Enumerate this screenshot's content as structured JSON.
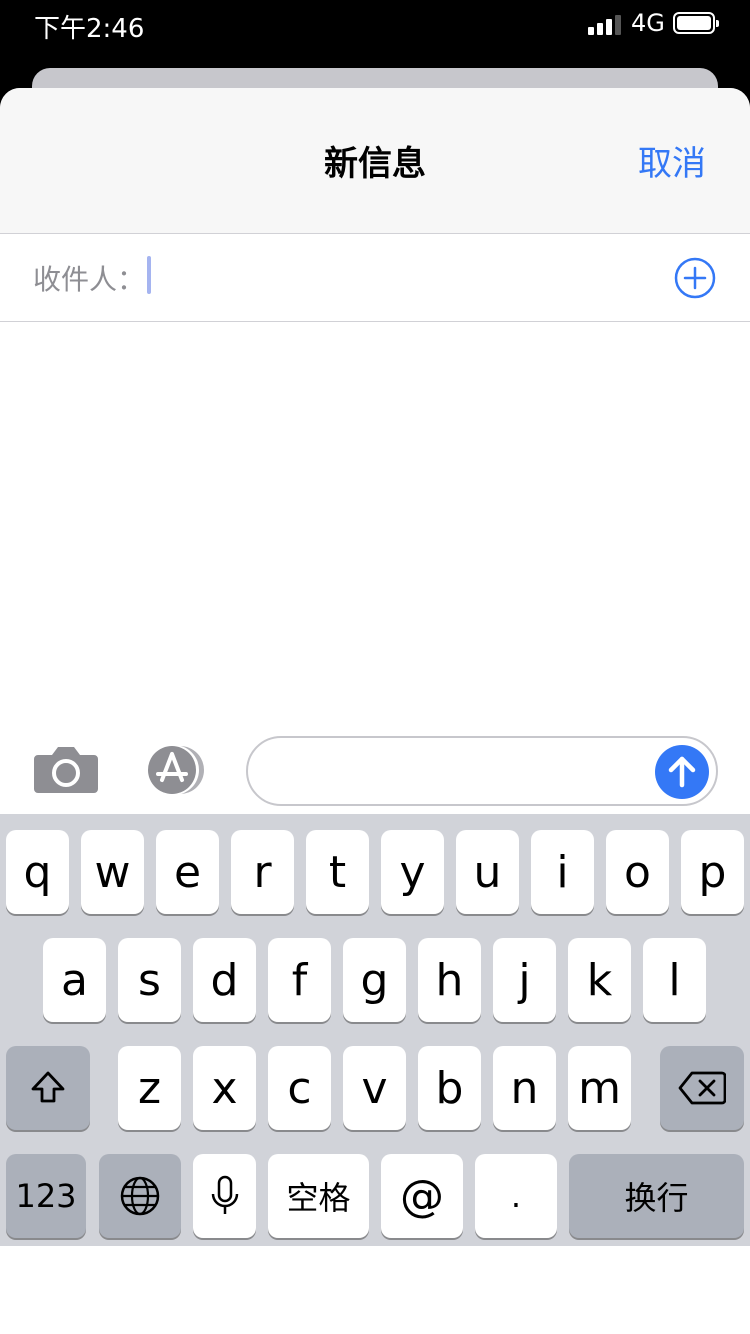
{
  "status_bar": {
    "time": "下午2:46",
    "network": "4G"
  },
  "nav": {
    "title": "新信息",
    "cancel_label": "取消"
  },
  "compose": {
    "to_label": "收件人："
  },
  "keyboard": {
    "row1": [
      "q",
      "w",
      "e",
      "r",
      "t",
      "y",
      "u",
      "i",
      "o",
      "p"
    ],
    "row2": [
      "a",
      "s",
      "d",
      "f",
      "g",
      "h",
      "j",
      "k",
      "l"
    ],
    "row3": [
      "z",
      "x",
      "c",
      "v",
      "b",
      "n",
      "m"
    ],
    "numbers_label": "123",
    "space_label": "空格",
    "at_label": "@",
    "period_label": ".",
    "return_label": "换行"
  },
  "colors": {
    "accent": "#3478f6",
    "keyboard_bg": "#d1d3d9",
    "dark_key": "#abb0ba"
  },
  "icons": [
    "camera-icon",
    "appstore-icon",
    "photos-app-icon",
    "appstore-app-icon",
    "memoji-app-icon",
    "fitness-app-icon",
    "more-apps-icon",
    "send-arrow-icon",
    "add-contact-icon",
    "shift-icon",
    "delete-icon",
    "globe-icon",
    "microphone-icon"
  ]
}
